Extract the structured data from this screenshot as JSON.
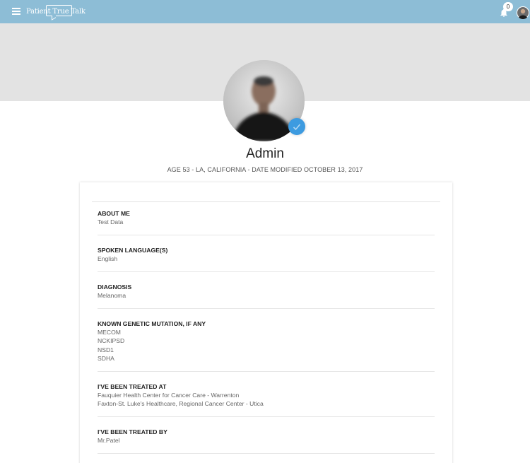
{
  "app": {
    "logo_text": "Patient True Talk",
    "notification_count": "0"
  },
  "profile": {
    "name": "Admin",
    "meta": "AGE 53 - LA, CALIFORNIA - DATE MODIFIED OCTOBER 13, 2017"
  },
  "sections": {
    "about": {
      "title": "ABOUT ME",
      "lines": [
        "Test Data"
      ]
    },
    "languages": {
      "title": "SPOKEN LANGUAGE(S)",
      "lines": [
        "English"
      ]
    },
    "diagnosis": {
      "title": "DIAGNOSIS",
      "lines": [
        "Melanoma"
      ]
    },
    "mutation": {
      "title": "KNOWN GENETIC MUTATION, IF ANY",
      "lines": [
        "MECOM",
        "NCKIPSD",
        "NSD1",
        "SDHA"
      ]
    },
    "treated_at": {
      "title": "I'VE BEEN TREATED AT",
      "lines": [
        "Fauquier Health Center for Cancer Care - Warrenton",
        "Faxton-St. Luke's Healthcare, Regional Cancer Center - Utica"
      ]
    },
    "treated_by": {
      "title": "I'VE BEEN TREATED BY",
      "lines": [
        "Mr.Patel"
      ]
    }
  },
  "colors": {
    "topbar": "#8dbdd6",
    "banner": "#e3e3e3",
    "accent": "#3d9be0"
  },
  "icons": {
    "menu": "menu-icon",
    "bell": "bell-icon",
    "edit": "edit-badge-icon"
  }
}
